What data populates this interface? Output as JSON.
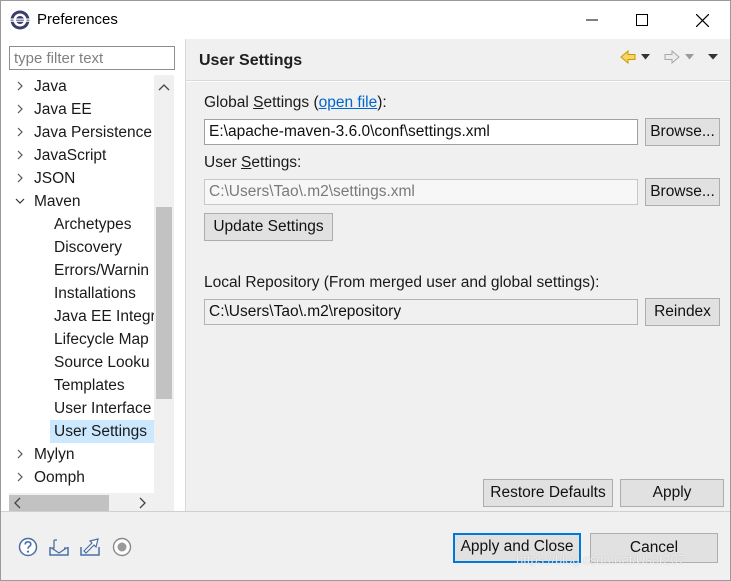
{
  "window": {
    "title": "Preferences"
  },
  "filter": {
    "placeholder": "type filter text"
  },
  "tree": {
    "items": [
      {
        "label": "Java",
        "level": "top",
        "state": "collapsed"
      },
      {
        "label": "Java EE",
        "level": "top",
        "state": "collapsed"
      },
      {
        "label": "Java Persistence",
        "level": "top",
        "state": "collapsed"
      },
      {
        "label": "JavaScript",
        "level": "top",
        "state": "collapsed"
      },
      {
        "label": "JSON",
        "level": "top",
        "state": "collapsed"
      },
      {
        "label": "Maven",
        "level": "top",
        "state": "expanded"
      },
      {
        "label": "Archetypes",
        "level": "child"
      },
      {
        "label": "Discovery",
        "level": "child"
      },
      {
        "label": "Errors/Warnin",
        "level": "child"
      },
      {
        "label": "Installations",
        "level": "child"
      },
      {
        "label": "Java EE Integra",
        "level": "child"
      },
      {
        "label": "Lifecycle Map",
        "level": "child"
      },
      {
        "label": "Source Looku",
        "level": "child"
      },
      {
        "label": "Templates",
        "level": "child"
      },
      {
        "label": "User Interface",
        "level": "child"
      },
      {
        "label": "User Settings",
        "level": "child",
        "selected": true
      },
      {
        "label": "Mylyn",
        "level": "top",
        "state": "collapsed"
      },
      {
        "label": "Oomph",
        "level": "top",
        "state": "collapsed"
      }
    ]
  },
  "page": {
    "title": "User Settings",
    "global_label_pre": "Global ",
    "global_label_u": "S",
    "global_label_post": "ettings (",
    "global_link": "open file",
    "global_label_end": "):",
    "global_value": "E:\\apache-maven-3.6.0\\conf\\settings.xml",
    "browse_label": "Browse...",
    "user_label_pre": "User ",
    "user_label_u": "S",
    "user_label_post": "ettings:",
    "user_value": "C:\\Users\\Tao\\.m2\\settings.xml",
    "update_label": "Update Settings",
    "local_repo_label": "Local Repository (From merged user and global settings):",
    "local_repo_value": "C:\\Users\\Tao\\.m2\\repository",
    "reindex_label": "Reindex",
    "restore_label": "Restore Defaults",
    "apply_label": "Apply"
  },
  "footer": {
    "apply_close_label": "Apply and Close",
    "cancel_label": "Cancel",
    "watermark": "https://blog.csdn.net/User207"
  },
  "colors": {
    "accent": "#0078d7",
    "link": "#0066cc",
    "selection": "#cce8ff",
    "nav_back": "#e8b400"
  }
}
